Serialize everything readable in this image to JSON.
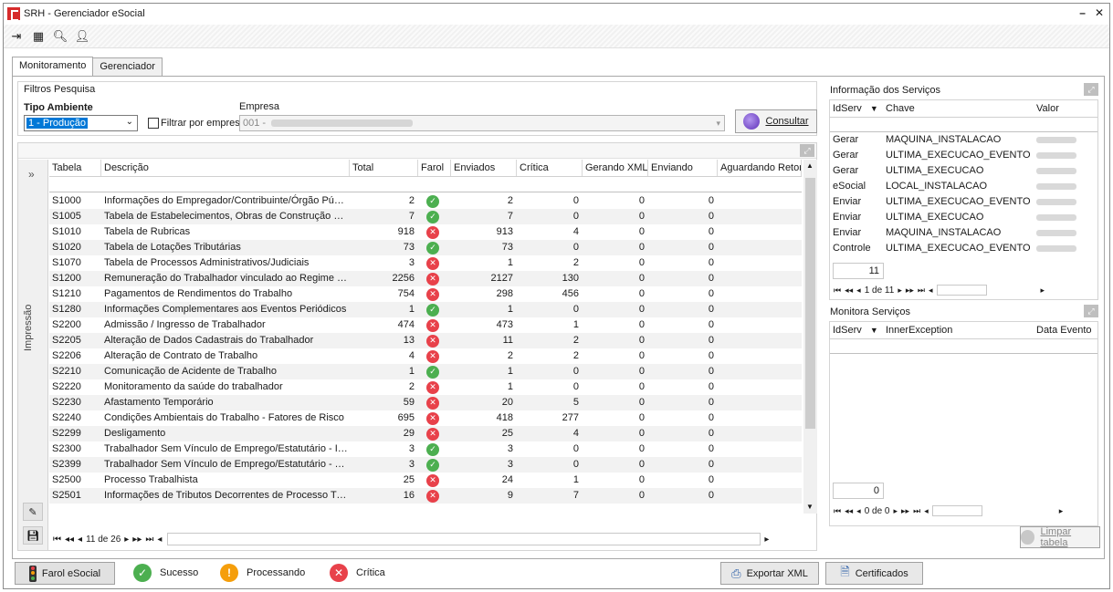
{
  "window": {
    "title": "SRH - Gerenciador eSocial",
    "minimize": "–",
    "close": "✕"
  },
  "toolbar": {
    "icons": [
      "exit-icon",
      "grid-icon",
      "search-icon",
      "user-config-icon"
    ]
  },
  "tabs": [
    {
      "label": "Monitoramento",
      "active": true
    },
    {
      "label": "Gerenciador",
      "active": false
    }
  ],
  "filters": {
    "group_title": "Filtros Pesquisa",
    "tipo_label": "Tipo Ambiente",
    "tipo_value": "1 - Produção",
    "filtrar_label": "Filtrar por empresa",
    "empresa_label": "Empresa",
    "empresa_value": "001 -",
    "consultar": "Consultar"
  },
  "side": {
    "label": "Impressão"
  },
  "table": {
    "headers": [
      "Tabela",
      "Descrição",
      "Total",
      "Farol",
      "Enviados",
      "Crítica",
      "Gerando XML",
      "Enviando",
      "Aguardando Retorno"
    ],
    "rows": [
      [
        "S1000",
        "Informações do Empregador/Contribuinte/Órgão Público",
        "2",
        "ok",
        "2",
        "0",
        "0",
        "0"
      ],
      [
        "S1005",
        "Tabela de Estabelecimentos, Obras de Construção Civil ou ...",
        "7",
        "ok",
        "7",
        "0",
        "0",
        "0"
      ],
      [
        "S1010",
        "Tabela de Rubricas",
        "918",
        "err",
        "913",
        "4",
        "0",
        "0"
      ],
      [
        "S1020",
        "Tabela de Lotações Tributárias",
        "73",
        "ok",
        "73",
        "0",
        "0",
        "0"
      ],
      [
        "S1070",
        "Tabela de Processos Administrativos/Judiciais",
        "3",
        "err",
        "1",
        "2",
        "0",
        "0"
      ],
      [
        "S1200",
        "Remuneração do Trabalhador vinculado ao Regime Geral de...",
        "2256",
        "err",
        "2127",
        "130",
        "0",
        "0"
      ],
      [
        "S1210",
        "Pagamentos de Rendimentos do Trabalho",
        "754",
        "err",
        "298",
        "456",
        "0",
        "0"
      ],
      [
        "S1280",
        "Informações Complementares aos Eventos Periódicos",
        "1",
        "ok",
        "1",
        "0",
        "0",
        "0"
      ],
      [
        "S2200",
        "Admissão / Ingresso de Trabalhador",
        "474",
        "err",
        "473",
        "1",
        "0",
        "0"
      ],
      [
        "S2205",
        "Alteração de Dados Cadastrais do Trabalhador",
        "13",
        "err",
        "11",
        "2",
        "0",
        "0"
      ],
      [
        "S2206",
        "Alteração de Contrato de Trabalho",
        "4",
        "err",
        "2",
        "2",
        "0",
        "0"
      ],
      [
        "S2210",
        "Comunicação de Acidente de Trabalho",
        "1",
        "ok",
        "1",
        "0",
        "0",
        "0"
      ],
      [
        "S2220",
        "Monitoramento da saúde do trabalhador",
        "2",
        "err",
        "1",
        "0",
        "0",
        "0"
      ],
      [
        "S2230",
        "Afastamento Temporário",
        "59",
        "err",
        "20",
        "5",
        "0",
        "0"
      ],
      [
        "S2240",
        "Condições Ambientais do Trabalho - Fatores de Risco",
        "695",
        "err",
        "418",
        "277",
        "0",
        "0"
      ],
      [
        "S2299",
        "Desligamento",
        "29",
        "err",
        "25",
        "4",
        "0",
        "0"
      ],
      [
        "S2300",
        "Trabalhador Sem Vínculo de Emprego/Estatutário - Início",
        "3",
        "ok",
        "3",
        "0",
        "0",
        "0"
      ],
      [
        "S2399",
        "Trabalhador Sem Vínculo de Emprego/Estatutário - Término",
        "3",
        "ok",
        "3",
        "0",
        "0",
        "0"
      ],
      [
        "S2500",
        "Processo Trabalhista",
        "25",
        "err",
        "24",
        "1",
        "0",
        "0"
      ],
      [
        "S2501",
        "Informações de Tributos Decorrentes de Processo Trabalhista",
        "16",
        "err",
        "9",
        "7",
        "0",
        "0"
      ]
    ],
    "pager": "11 de 26"
  },
  "info": {
    "title": "Informação dos Serviços",
    "headers": [
      "IdServ",
      "Chave",
      "Valor"
    ],
    "rows": [
      [
        "Gerar",
        "MAQUINA_INSTALACAO"
      ],
      [
        "Gerar",
        "ULTIMA_EXECUCAO_EVENTO"
      ],
      [
        "Gerar",
        "ULTIMA_EXECUCAO"
      ],
      [
        "eSocial",
        "LOCAL_INSTALACAO"
      ],
      [
        "Enviar",
        "ULTIMA_EXECUCAO_EVENTO"
      ],
      [
        "Enviar",
        "ULTIMA_EXECUCAO"
      ],
      [
        "Enviar",
        "MAQUINA_INSTALACAO"
      ],
      [
        "Controle",
        "ULTIMA_EXECUCAO_EVENTO"
      ]
    ],
    "count": "11",
    "pager": "1 de 11"
  },
  "monitor": {
    "title": "Monitora Serviços",
    "headers": [
      "IdServ",
      "InnerException",
      "Data Evento"
    ],
    "count": "0",
    "pager": "0 de 0",
    "limpar": "Limpar tabela"
  },
  "status": {
    "farol": "Farol eSocial",
    "sucesso": "Sucesso",
    "processando": "Processando",
    "critica": "Crítica",
    "exportar": "Exportar XML",
    "certificados": "Certificados"
  },
  "colors": {
    "ok": "#4caf50",
    "err": "#e8414a",
    "warn": "#f59e0b",
    "selection": "#0078d7"
  }
}
